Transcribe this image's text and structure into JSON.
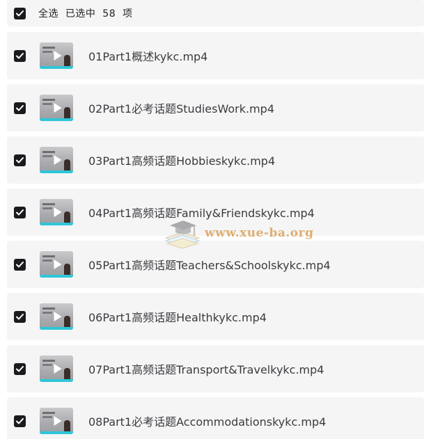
{
  "header": {
    "select_all_text": "全选  已选中  58  项"
  },
  "files": [
    {
      "name": "01Part1概述kykc.mp4",
      "checked": true
    },
    {
      "name": "02Part1必考话题StudiesWork.mp4",
      "checked": true
    },
    {
      "name": "03Part1高频话题Hobbieskykc.mp4",
      "checked": true
    },
    {
      "name": "04Part1高频话题Family&Friendskykc.mp4",
      "checked": true
    },
    {
      "name": "05Part1高频话题Teachers&Schoolskykc.mp4",
      "checked": true
    },
    {
      "name": "06Part1高频话题Healthkykc.mp4",
      "checked": true
    },
    {
      "name": "07Part1高频话题Transport&Travelkykc.mp4",
      "checked": true
    },
    {
      "name": "08Part1必考话题Accommodationskykc.mp4",
      "checked": true
    }
  ],
  "watermark": {
    "text": "www.xue-ba.org"
  },
  "colors": {
    "row_background": "#f5f5f6",
    "checkbox": "#1b1b1f",
    "thumb_strip": "#2ec6d8"
  }
}
